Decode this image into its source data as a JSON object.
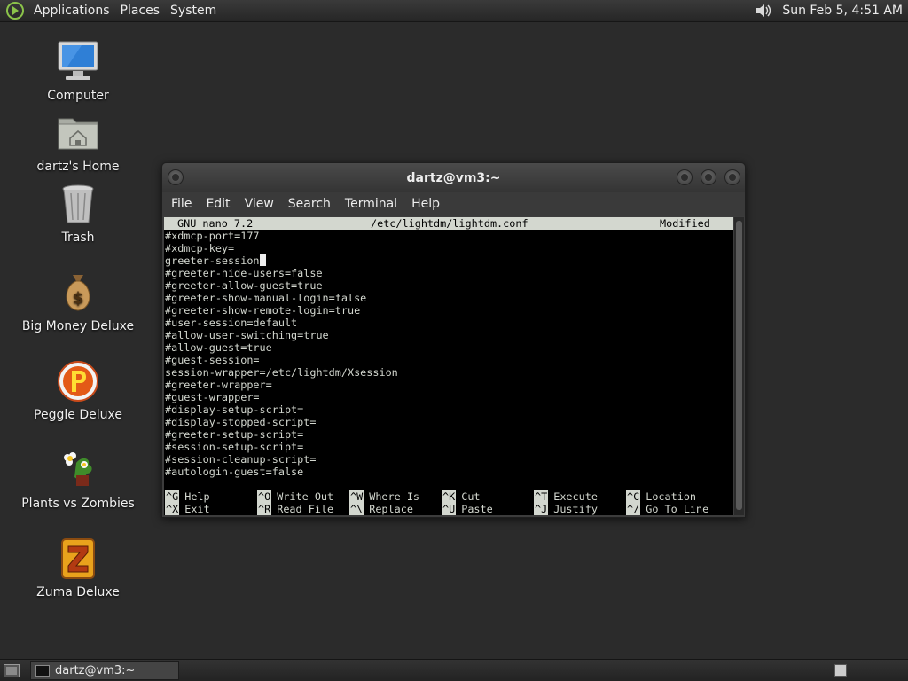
{
  "top_panel": {
    "menus": [
      "Applications",
      "Places",
      "System"
    ],
    "clock": "Sun Feb  5,  4:51 AM"
  },
  "desktop_icons": [
    {
      "label": "Computer",
      "icon": "computer-icon"
    },
    {
      "label": "dartz's Home",
      "icon": "home-folder-icon"
    },
    {
      "label": "Trash",
      "icon": "trash-icon"
    },
    {
      "label": "Big Money Deluxe",
      "icon": "money-bag-icon"
    },
    {
      "label": "Peggle Deluxe",
      "icon": "peggle-icon"
    },
    {
      "label": "Plants vs Zombies",
      "icon": "plants-icon"
    },
    {
      "label": "Zuma Deluxe",
      "icon": "zuma-icon"
    }
  ],
  "terminal": {
    "title": "dartz@vm3:~",
    "menu": [
      "File",
      "Edit",
      "View",
      "Search",
      "Terminal",
      "Help"
    ],
    "nano": {
      "version": "GNU nano 7.2",
      "filename": "/etc/lightdm/lightdm.conf",
      "status": "Modified",
      "lines": [
        "#xdmcp-port=177",
        "#xdmcp-key=",
        "greeter-session",
        "#greeter-hide-users=false",
        "#greeter-allow-guest=true",
        "#greeter-show-manual-login=false",
        "#greeter-show-remote-login=true",
        "#user-session=default",
        "#allow-user-switching=true",
        "#allow-guest=true",
        "#guest-session=",
        "session-wrapper=/etc/lightdm/Xsession",
        "#greeter-wrapper=",
        "#guest-wrapper=",
        "#display-setup-script=",
        "#display-stopped-script=",
        "#greeter-setup-script=",
        "#session-setup-script=",
        "#session-cleanup-script=",
        "#autologin-guest=false"
      ],
      "shortcuts_row1": [
        {
          "key": "^G",
          "label": "Help"
        },
        {
          "key": "^O",
          "label": "Write Out"
        },
        {
          "key": "^W",
          "label": "Where Is"
        },
        {
          "key": "^K",
          "label": "Cut"
        },
        {
          "key": "^T",
          "label": "Execute"
        },
        {
          "key": "^C",
          "label": "Location"
        }
      ],
      "shortcuts_row2": [
        {
          "key": "^X",
          "label": "Exit"
        },
        {
          "key": "^R",
          "label": "Read File"
        },
        {
          "key": "^\\",
          "label": "Replace"
        },
        {
          "key": "^U",
          "label": "Paste"
        },
        {
          "key": "^J",
          "label": "Justify"
        },
        {
          "key": "^/",
          "label": "Go To Line"
        }
      ]
    }
  },
  "taskbar": {
    "task_label": "dartz@vm3:~"
  }
}
